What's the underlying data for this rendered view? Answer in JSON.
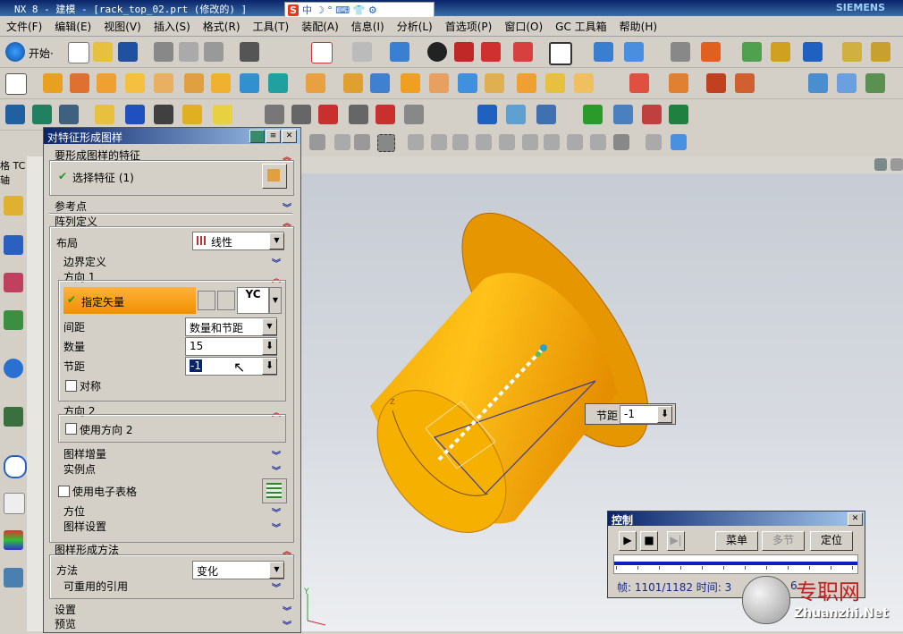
{
  "window": {
    "title": "NX 8 - 建模 - [rack_top_02.prt (修改的) ]",
    "brand": "SIEMENS"
  },
  "ime": {
    "logo": "S",
    "mode": "中",
    "icons": "☽ ° ⌨ 👕 ⚙"
  },
  "menu": [
    "文件(F)",
    "编辑(E)",
    "视图(V)",
    "插入(S)",
    "格式(R)",
    "工具(T)",
    "装配(A)",
    "信息(I)",
    "分析(L)",
    "首选项(P)",
    "窗口(O)",
    "GC 工具箱",
    "帮助(H)"
  ],
  "toolbar": {
    "start_label": "开始·"
  },
  "left_header": "格 TC 轴",
  "dialog": {
    "title": "对特征形成图样",
    "sections": {
      "features": "要形成图样的特征",
      "select_feature": "选择特征 (1)",
      "reference_point": "参考点",
      "array_def": "阵列定义",
      "layout_label": "布局",
      "layout_value": "线性",
      "boundary": "边界定义",
      "direction1": "方向 1",
      "specify_vector": "指定矢量",
      "vector_option": "YC",
      "spacing_label": "间距",
      "spacing_value": "数量和节距",
      "count_label": "数量",
      "count_value": "15",
      "pitch_label": "节距",
      "pitch_value": "-1",
      "symmetric": "对称",
      "direction2": "方向 2",
      "use_direction2": "使用方向 2",
      "increment": "图样增量",
      "instance_points": "实例点",
      "use_spreadsheet": "使用电子表格",
      "orientation": "方位",
      "pattern_settings": "图样设置",
      "method_header": "图样形成方法",
      "method_label": "方法",
      "method_value": "变化",
      "reusable_refs": "可重用的引用",
      "settings": "设置",
      "preview": "预览"
    }
  },
  "tooltip": {
    "label": "节距",
    "value": "-1"
  },
  "control": {
    "title": "控制",
    "menu_btn": "菜单",
    "section_btn": "多节",
    "position_btn": "定位",
    "status": "帧: 1101/1182 时间: 3",
    "status_tail": "6"
  },
  "watermark": {
    "cn": "专职网",
    "en": "Zhuanzhi.Net"
  },
  "colors": {
    "accent_orange": "#f5a400",
    "title_blue": "#0a246a",
    "check_green": "#1a9a1a"
  }
}
